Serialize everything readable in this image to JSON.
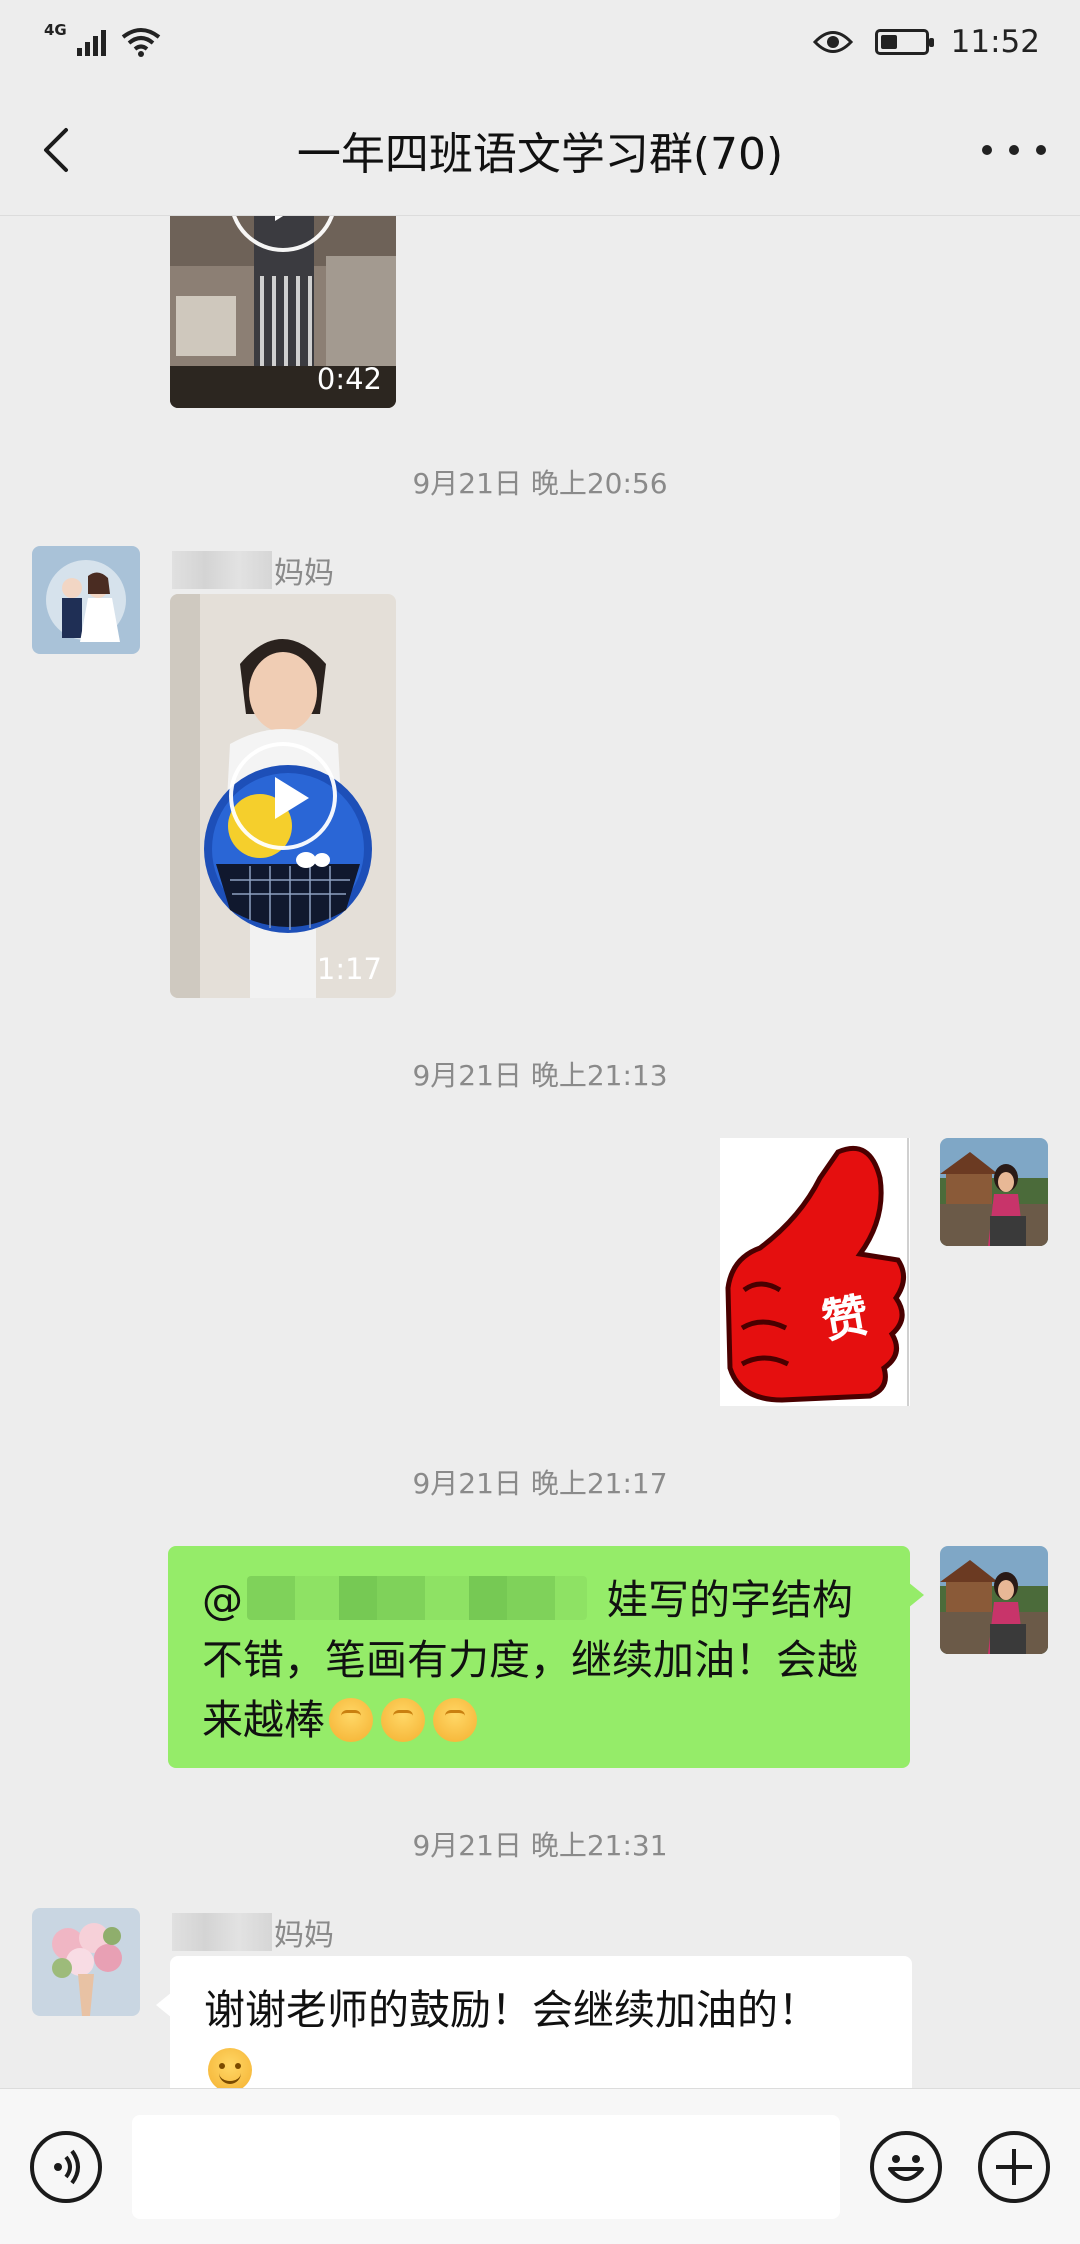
{
  "status_bar": {
    "network": "4G",
    "time": "11:52"
  },
  "nav": {
    "title": "一年四班语文学习群(70)"
  },
  "messages": {
    "video1": {
      "duration": "0:42"
    },
    "ts1": "9月21日 晚上20:56",
    "nick1_suffix": "妈妈",
    "video2": {
      "duration": "1:17"
    },
    "ts2": "9月21日 晚上21:13",
    "sticker_text": "赞",
    "ts3": "9月21日 晚上21:17",
    "msg3": {
      "at_sign": "@",
      "text": "娃写的字结构不错，笔画有力度，继续加油！会越来越棒"
    },
    "ts4": "9月21日 晚上21:31",
    "nick2_suffix": "妈妈",
    "msg4": {
      "text": "谢谢老师的鼓励！会继续加油的！"
    }
  },
  "input_bar": {
    "voice_icon": "voice-icon",
    "emoji_icon": "emoji-icon",
    "plus_icon": "plus-icon"
  },
  "colors": {
    "background": "#ededed",
    "green_bubble": "#95ec69",
    "white_bubble": "#ffffff",
    "timestamp": "#8a8a8a"
  }
}
